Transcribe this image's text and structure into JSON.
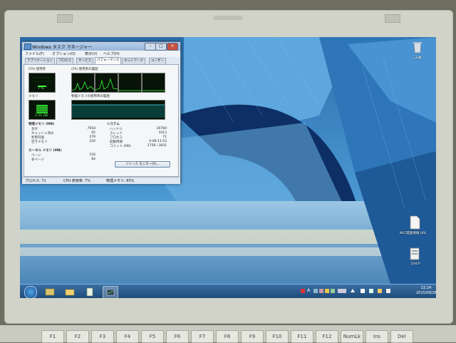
{
  "task_manager": {
    "title": "Windows タスク マネージャー",
    "menu": [
      "ファイル(F)",
      "オプション(O)",
      "表示(V)",
      "ヘルプ(H)"
    ],
    "tabs": [
      "アプリケーション",
      "プロセス",
      "サービス",
      "パフォーマンス",
      "ネットワーク",
      "ユーザー"
    ],
    "active_tab": "パフォーマンス",
    "cpu_usage_label": "CPU 使用率",
    "cpu_usage_value": "7 %",
    "cpu_history_label": "CPU 使用率の履歴",
    "memory_label": "メモリ",
    "memory_value": "1.51 GB",
    "memory_history_label": "物理メモリの使用率の履歴",
    "physical_memory": {
      "heading": "物理メモリ (MB)",
      "rows": [
        {
          "label": "合計",
          "value": "7918"
        },
        {
          "label": "キャッシュ済み",
          "value": "65"
        },
        {
          "label": "利用可能",
          "value": "279"
        },
        {
          "label": "空きメモリ",
          "value": "220"
        }
      ]
    },
    "system": {
      "heading": "システム",
      "rows": [
        {
          "label": "ハンドル",
          "value": "20784"
        },
        {
          "label": "スレッド",
          "value": "1013"
        },
        {
          "label": "プロセス",
          "value": "71"
        },
        {
          "label": "起動時間",
          "value": "0:08:11:53"
        },
        {
          "label": "コミット (MB)",
          "value": "1758 / 3831"
        }
      ]
    },
    "kernel_memory": {
      "heading": "カーネル メモリ (MB)",
      "rows": [
        {
          "label": "ページ",
          "value": "156"
        },
        {
          "label": "非ページ",
          "value": "84"
        }
      ]
    },
    "resource_monitor_button": "リソース モニター(R)...",
    "status": {
      "processes": "プロセス: 71",
      "cpu": "CPU 使用率: 7%",
      "memory": "物理メモリ: 85%"
    }
  },
  "desktop": {
    "icons": [
      {
        "label": "ごみ箱"
      },
      {
        "label": "NEC関連情報.URL"
      },
      {
        "label": "DHCP"
      }
    ]
  },
  "taskbar": {
    "clock_time": "22:24",
    "clock_date": "2015/09/28",
    "ime_mode": "A"
  },
  "keyboard": {
    "keys": [
      "F1",
      "F2",
      "F3",
      "F4",
      "F5",
      "F6",
      "F7",
      "F8",
      "F9",
      "F10",
      "F11",
      "F12",
      "NumLk",
      "Ins",
      "Del"
    ]
  }
}
